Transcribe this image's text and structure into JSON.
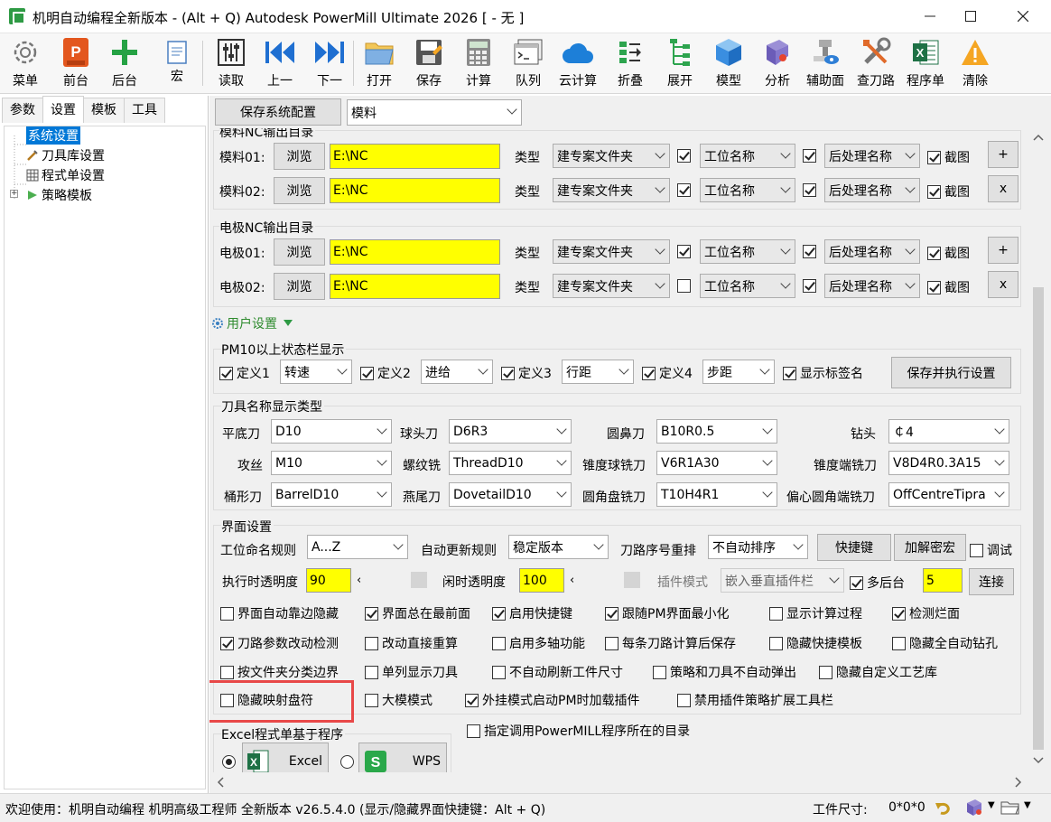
{
  "window": {
    "title": "机明自动编程全新版本 - (Alt + Q) Autodesk PowerMill Ultimate 2026   [ - 无 ]"
  },
  "toolbar": {
    "items": [
      {
        "label": "菜单",
        "icon": "gear-icon"
      },
      {
        "label": "前台",
        "icon": "powermill-icon"
      },
      {
        "label": "后台",
        "icon": "plus-icon"
      },
      {
        "label": "宏",
        "icon": "macro-icon"
      },
      {
        "label": "读取",
        "icon": "sliders-icon"
      },
      {
        "label": "上一",
        "icon": "skip-back-icon"
      },
      {
        "label": "下一",
        "icon": "skip-forward-icon"
      },
      {
        "label": "打开",
        "icon": "folder-icon"
      },
      {
        "label": "保存",
        "icon": "save-icon"
      },
      {
        "label": "计算",
        "icon": "calculator-icon"
      },
      {
        "label": "队列",
        "icon": "terminal-icon"
      },
      {
        "label": "云计算",
        "icon": "cloud-icon"
      },
      {
        "label": "折叠",
        "icon": "collapse-icon"
      },
      {
        "label": "展开",
        "icon": "expand-icon"
      },
      {
        "label": "模型",
        "icon": "cube-icon"
      },
      {
        "label": "分析",
        "icon": "analysis-icon"
      },
      {
        "label": "辅助面",
        "icon": "auxiliary-icon"
      },
      {
        "label": "查刀路",
        "icon": "tools-icon"
      },
      {
        "label": "程序单",
        "icon": "excel-icon"
      },
      {
        "label": "清除",
        "icon": "warning-icon"
      }
    ]
  },
  "left_panel": {
    "tabs": [
      "参数",
      "设置",
      "模板",
      "工具"
    ],
    "active_tab": "设置",
    "tree": [
      "系统设置",
      "刀具库设置",
      "程式单设置",
      "策略模板"
    ]
  },
  "top": {
    "save_config": "保存系统配置",
    "profile": "模料"
  },
  "nc_mold": {
    "header": "模料NC输出目录",
    "rows": [
      {
        "label": "模料01:",
        "browse": "浏览",
        "path": "E:\\NC",
        "type_label": "类型",
        "type": "建专案文件夹",
        "op": "工位名称",
        "post": "后处理名称",
        "shot": "截图",
        "side": "+"
      },
      {
        "label": "模料02:",
        "browse": "浏览",
        "path": "E:\\NC",
        "type_label": "类型",
        "type": "建专案文件夹",
        "op": "工位名称",
        "post": "后处理名称",
        "shot": "截图",
        "side": "x"
      }
    ]
  },
  "nc_electrode": {
    "header": "电极NC输出目录",
    "rows": [
      {
        "label": "电极01:",
        "browse": "浏览",
        "path": "E:\\NC",
        "type_label": "类型",
        "type": "建专案文件夹",
        "op": "工位名称",
        "post": "后处理名称",
        "shot": "截图",
        "side": "+"
      },
      {
        "label": "电极02:",
        "browse": "浏览",
        "path": "E:\\NC",
        "type_label": "类型",
        "type": "建专案文件夹",
        "op": "工位名称",
        "post": "后处理名称",
        "shot": "截图",
        "side": "x"
      }
    ]
  },
  "user_settings": "用户设置",
  "statusbar_group": {
    "header": "PM10以上状态栏显示",
    "defs": [
      {
        "label": "定义1",
        "value": "转速"
      },
      {
        "label": "定义2",
        "value": "进给"
      },
      {
        "label": "定义3",
        "value": "行距"
      },
      {
        "label": "定义4",
        "value": "步距"
      }
    ],
    "show_tag": "显示标签名",
    "save_apply": "保存并执行设置"
  },
  "tool_names": {
    "header": "刀具名称显示类型",
    "fields": [
      {
        "label": "平底刀",
        "value": "D10"
      },
      {
        "label": "球头刀",
        "value": "D6R3"
      },
      {
        "label": "圆鼻刀",
        "value": "B10R0.5"
      },
      {
        "label": "钻头",
        "value": "￠4"
      },
      {
        "label": "攻丝",
        "value": "M10"
      },
      {
        "label": "螺纹铣",
        "value": "ThreadD10"
      },
      {
        "label": "锥度球铣刀",
        "value": "V6R1A30"
      },
      {
        "label": "锥度端铣刀",
        "value": "V8D4R0.3A15"
      },
      {
        "label": "桶形刀",
        "value": "BarrelD10"
      },
      {
        "label": "燕尾刀",
        "value": "DovetailD10"
      },
      {
        "label": "圆角盘铣刀",
        "value": "T10H4R1"
      },
      {
        "label": "偏心圆角端铣刀",
        "value": "OffCentreTipra"
      }
    ]
  },
  "ui_settings": {
    "header": "界面设置",
    "naming_label": "工位命名规则",
    "naming_value": "A...Z",
    "update_label": "自动更新规则",
    "update_value": "稳定版本",
    "reorder_label": "刀路序号重排",
    "reorder_value": "不自动排序",
    "shortcut_btn": "快捷键",
    "decrypt_btn": "加解密宏",
    "debug": "调试",
    "exec_alpha_label": "执行时透明度",
    "exec_alpha": "90",
    "idle_alpha_label": "闲时透明度",
    "idle_alpha": "100",
    "plugin_label": "插件模式",
    "plugin_value": "嵌入垂直插件栏",
    "multi_bg": "多后台",
    "multi_bg_value": "5",
    "connect_btn": "连接",
    "checks": [
      {
        "label": "界面自动靠边隐藏",
        "checked": false
      },
      {
        "label": "界面总在最前面",
        "checked": true
      },
      {
        "label": "启用快捷键",
        "checked": true
      },
      {
        "label": "跟随PM界面最小化",
        "checked": true
      },
      {
        "label": "显示计算过程",
        "checked": false
      },
      {
        "label": "检测烂面",
        "checked": true
      },
      {
        "label": "刀路参数改动检测",
        "checked": true
      },
      {
        "label": "改动直接重算",
        "checked": false
      },
      {
        "label": "启用多轴功能",
        "checked": false
      },
      {
        "label": "每条刀路计算后保存",
        "checked": false
      },
      {
        "label": "隐藏快捷模板",
        "checked": false
      },
      {
        "label": "隐藏全自动钻孔",
        "checked": false
      },
      {
        "label": "按文件夹分类边界",
        "checked": false
      },
      {
        "label": "单列显示刀具",
        "checked": false
      },
      {
        "label": "不自动刷新工件尺寸",
        "checked": false
      },
      {
        "label": "策略和刀具不自动弹出",
        "checked": false
      },
      {
        "label": "隐藏自定义工艺库",
        "checked": false
      },
      {
        "label": "隐藏映射盘符",
        "checked": false
      },
      {
        "label": "大模模式",
        "checked": false
      },
      {
        "label": "外挂模式启动PM时加载插件",
        "checked": true
      },
      {
        "label": "禁用插件策略扩展工具栏",
        "checked": false
      }
    ]
  },
  "excel_group": {
    "header": "Excel程式单基于程序",
    "excel": "Excel",
    "wps": "WPS",
    "pm_dir": "指定调用PowerMILL程序所在的目录"
  },
  "status": {
    "welcome": "欢迎使用：机明自动编程 机明高级工程师 全新版本 v26.5.4.0  (显示/隐藏界面快捷键：Alt + Q)",
    "size_label": "工件尺寸:",
    "size_value": "0*0*0"
  }
}
